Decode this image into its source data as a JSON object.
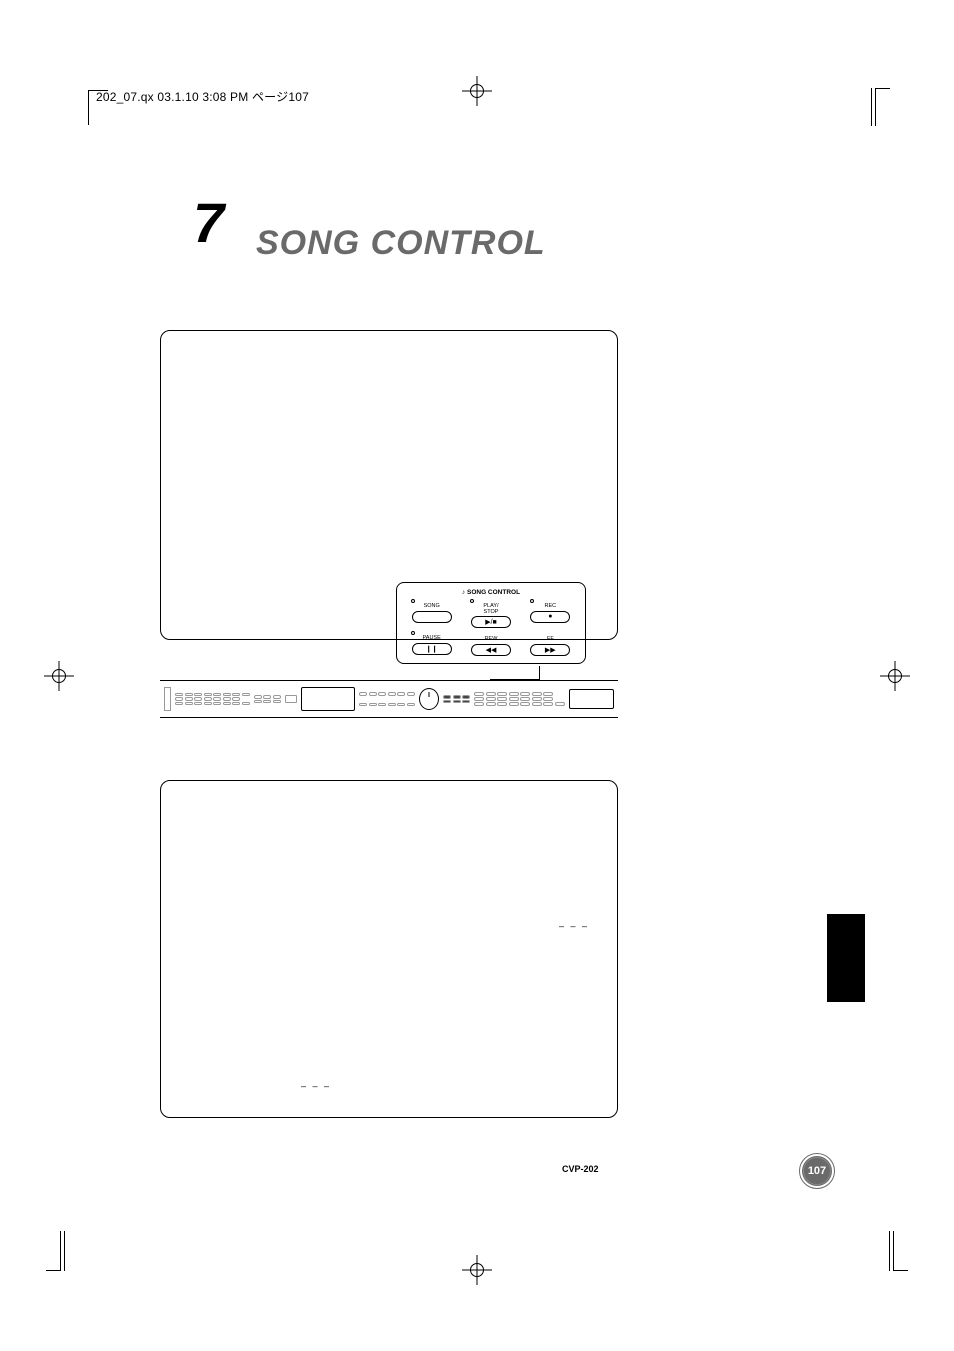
{
  "file_header": "202_07.qx  03.1.10  3:08 PM  ページ107",
  "chapter": {
    "number": "7",
    "title": "SONG CONTROL"
  },
  "panel": {
    "title": "SONG CONTROL",
    "row1": [
      {
        "led": true,
        "label": "SONG",
        "icon": ""
      },
      {
        "led": true,
        "label": "PLAY/\nSTOP",
        "icon": "▶/■"
      },
      {
        "led": true,
        "label": "REC",
        "icon": "●"
      }
    ],
    "row2": [
      {
        "led": true,
        "label": "PAUSE",
        "icon": "❙❙"
      },
      {
        "led": false,
        "label": "REW",
        "icon": "◀◀"
      },
      {
        "led": false,
        "label": "FF",
        "icon": "▶▶"
      }
    ]
  },
  "dashes": "– – –",
  "footer": {
    "model": "CVP-202",
    "page": "107"
  }
}
